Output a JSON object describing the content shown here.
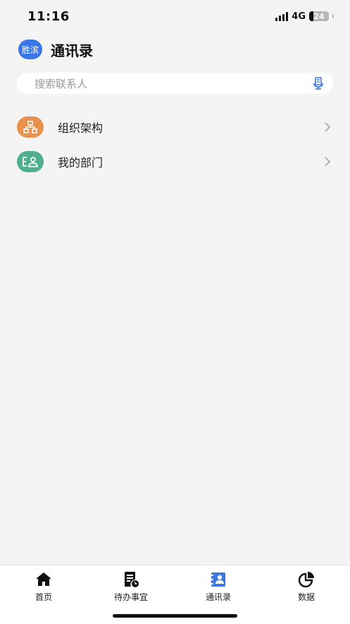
{
  "status_bar": {
    "time": "11:16",
    "network": "4G",
    "battery": "24"
  },
  "header": {
    "avatar_text": "胜滨",
    "title": "通讯录"
  },
  "search": {
    "placeholder": "搜索联系人"
  },
  "list": {
    "items": [
      {
        "label": "组织架构",
        "icon": "org-chart-icon",
        "color": "#e8914d"
      },
      {
        "label": "我的部门",
        "icon": "department-icon",
        "color": "#4faf8e"
      }
    ]
  },
  "tabbar": {
    "tabs": [
      {
        "label": "首页",
        "icon": "home-icon"
      },
      {
        "label": "待办事宜",
        "icon": "todo-icon"
      },
      {
        "label": "通讯录",
        "icon": "contacts-icon",
        "active": true
      },
      {
        "label": "数据",
        "icon": "pie-chart-icon"
      }
    ]
  },
  "colors": {
    "accent": "#3a76e6",
    "background": "#f4f4f4"
  }
}
